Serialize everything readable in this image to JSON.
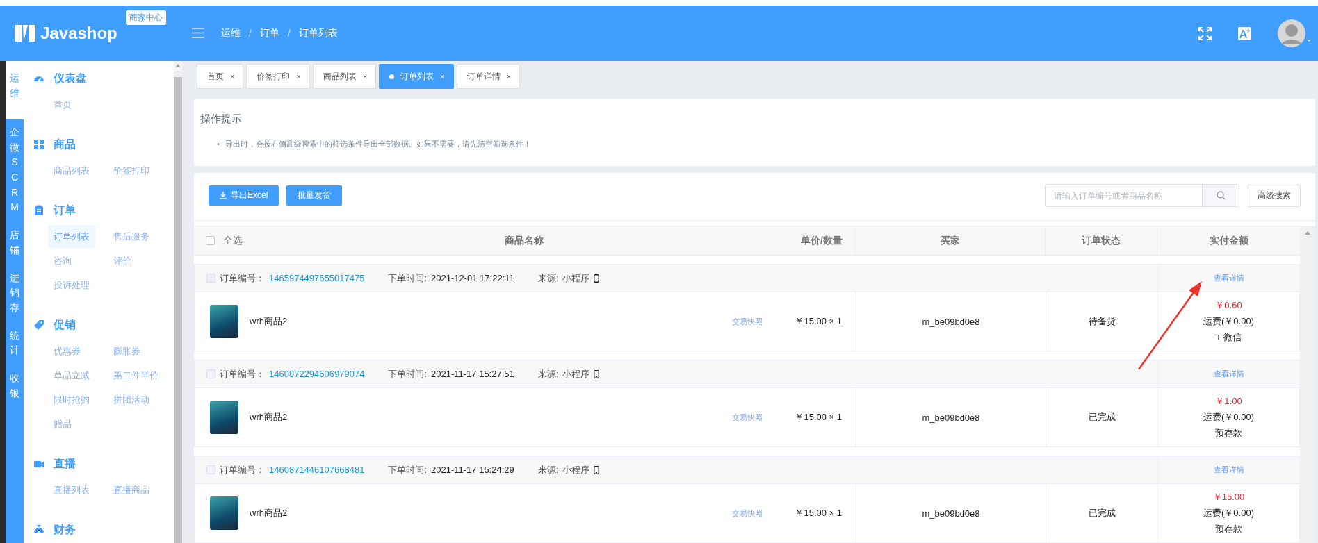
{
  "header": {
    "logo": "Javashop",
    "badge": "商家中心",
    "separator": "/",
    "breadcrumb": [
      {
        "label": "运维"
      },
      {
        "label": "订单"
      },
      {
        "label": "订单列表"
      }
    ]
  },
  "rail": [
    {
      "label": "运维",
      "selected": true
    },
    {
      "label": "企微SCRM",
      "selected": false
    },
    {
      "label": "店铺",
      "selected": false
    },
    {
      "label": "进销存",
      "selected": false
    },
    {
      "label": "统计",
      "selected": false
    },
    {
      "label": "收银",
      "selected": false
    }
  ],
  "menu": [
    {
      "title": "仪表盘",
      "items": [
        {
          "label": "首页",
          "selected": false
        }
      ]
    },
    {
      "title": "商品",
      "items": [
        {
          "label": "商品列表",
          "selected": false
        },
        {
          "label": "价签打印",
          "selected": false
        }
      ]
    },
    {
      "title": "订单",
      "items": [
        {
          "label": "订单列表",
          "selected": true
        },
        {
          "label": "售后服务",
          "selected": false
        },
        {
          "label": "咨询",
          "selected": false
        },
        {
          "label": "评价",
          "selected": false
        },
        {
          "label": "投诉处理",
          "selected": false
        }
      ]
    },
    {
      "title": "促销",
      "items": [
        {
          "label": "优惠券",
          "selected": false
        },
        {
          "label": "膨胀券",
          "selected": false
        },
        {
          "label": "单品立减",
          "selected": false
        },
        {
          "label": "第二件半价",
          "selected": false
        },
        {
          "label": "限时抢购",
          "selected": false
        },
        {
          "label": "拼团活动",
          "selected": false
        },
        {
          "label": "赠品",
          "selected": false
        }
      ]
    },
    {
      "title": "直播",
      "items": [
        {
          "label": "直播列表",
          "selected": false
        },
        {
          "label": "直播商品",
          "selected": false
        }
      ]
    },
    {
      "title": "财务"
    }
  ],
  "tabs": [
    {
      "label": "首页",
      "selected": false,
      "close": "×"
    },
    {
      "label": "价签打印",
      "selected": false,
      "close": "×"
    },
    {
      "label": "商品列表",
      "selected": false,
      "close": "×"
    },
    {
      "label": "订单列表",
      "selected": true,
      "close": "×"
    },
    {
      "label": "订单详情",
      "selected": false,
      "close": "×"
    }
  ],
  "hint": {
    "title": "操作提示",
    "items": [
      {
        "marker": "•",
        "text": "导出时，会按右侧高级搜索中的筛选条件导出全部数据。如果不需要，请先清空筛选条件！"
      }
    ]
  },
  "toolbar": {
    "buttons": [
      {
        "label": "导出Excel",
        "kind": "download"
      },
      {
        "label": "批量发货",
        "kind": "plain"
      }
    ],
    "search": {
      "placeholder": "请输入订单编号或者商品名称"
    },
    "advanced": "高级搜索"
  },
  "table": {
    "select_all": {
      "label": "全选",
      "checked": false
    },
    "columns": [
      "商品名称",
      "单价/数量",
      "买家",
      "订单状态",
      "实付金额"
    ],
    "orders": [
      {
        "checked": false,
        "number_label": "订单编号：",
        "number": "1465974497655017475",
        "time_label": "下单时间:",
        "time": "2021-12-01 17:22:11",
        "source_label": "来源:",
        "source": "小程序",
        "details_link": "查看详情",
        "product": "wrh商品2",
        "snapshot": "交易快照",
        "price_qty": "￥15.00 × 1",
        "buyer": "m_be09bd0e8",
        "status": "待备货",
        "paid": "￥0.60",
        "shipping": "运费(￥0.00)",
        "payment": "+ 微信"
      },
      {
        "checked": false,
        "number_label": "订单编号：",
        "number": "1460872294606979074",
        "time_label": "下单时间:",
        "time": "2021-11-17 15:27:51",
        "source_label": "来源:",
        "source": "小程序",
        "details_link": "查看详情",
        "product": "wrh商品2",
        "snapshot": "交易快照",
        "price_qty": "￥15.00 × 1",
        "buyer": "m_be09bd0e8",
        "status": "已完成",
        "paid": "￥1.00",
        "shipping": "运费(￥0.00)",
        "payment": "预存款"
      },
      {
        "checked": false,
        "number_label": "订单编号：",
        "number": "1460871446107668481",
        "time_label": "下单时间:",
        "time": "2021-11-17 15:24:29",
        "source_label": "来源:",
        "source": "小程序",
        "details_link": "查看详情",
        "product": "wrh商品2",
        "snapshot": "交易快照",
        "price_qty": "￥15.00 × 1",
        "buyer": "m_be09bd0e8",
        "status": "已完成",
        "paid": "￥15.00",
        "shipping": "运费(￥0.00)",
        "payment": "预存款"
      }
    ]
  }
}
